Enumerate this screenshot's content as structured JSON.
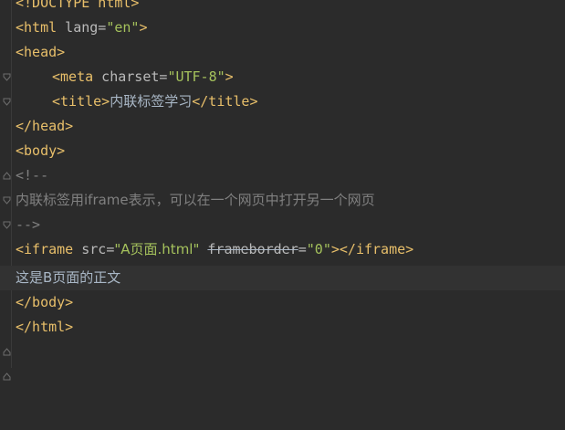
{
  "lines": {
    "doctype": "<!DOCTYPE html>",
    "html_open": "<html",
    "html_lang_attr": " lang=",
    "html_lang_val": "\"en\"",
    "html_open_end": ">",
    "head_open": "<head>",
    "meta_open": "<meta",
    "meta_attr": " charset=",
    "meta_val": "\"UTF-8\"",
    "meta_end": ">",
    "title_open": "<title>",
    "title_text": "内联标签学习",
    "title_close": "</title>",
    "head_close": "</head>",
    "body_open": "<body>",
    "comment_open": "<!--",
    "comment_text": "内联标签用iframe表示，可以在一个网页中打开另一个网页",
    "comment_close": "-->",
    "iframe_open": "<iframe",
    "iframe_src_attr": " src=",
    "iframe_src_val": "\"A页面.html\"",
    "iframe_fb_attr": "frameborder",
    "iframe_fb_eq": "=",
    "iframe_fb_val": "\"0\"",
    "iframe_end": "></iframe>",
    "body_text": "这是B页面的正文",
    "body_close": "</body>",
    "html_close": "</html>"
  },
  "colors": {
    "background": "#2b2b2b",
    "current_line": "#323232",
    "tag": "#e8bf6a",
    "attribute": "#bababa",
    "string": "#a5c25c",
    "text": "#a9b7c6",
    "comment": "#808080"
  }
}
